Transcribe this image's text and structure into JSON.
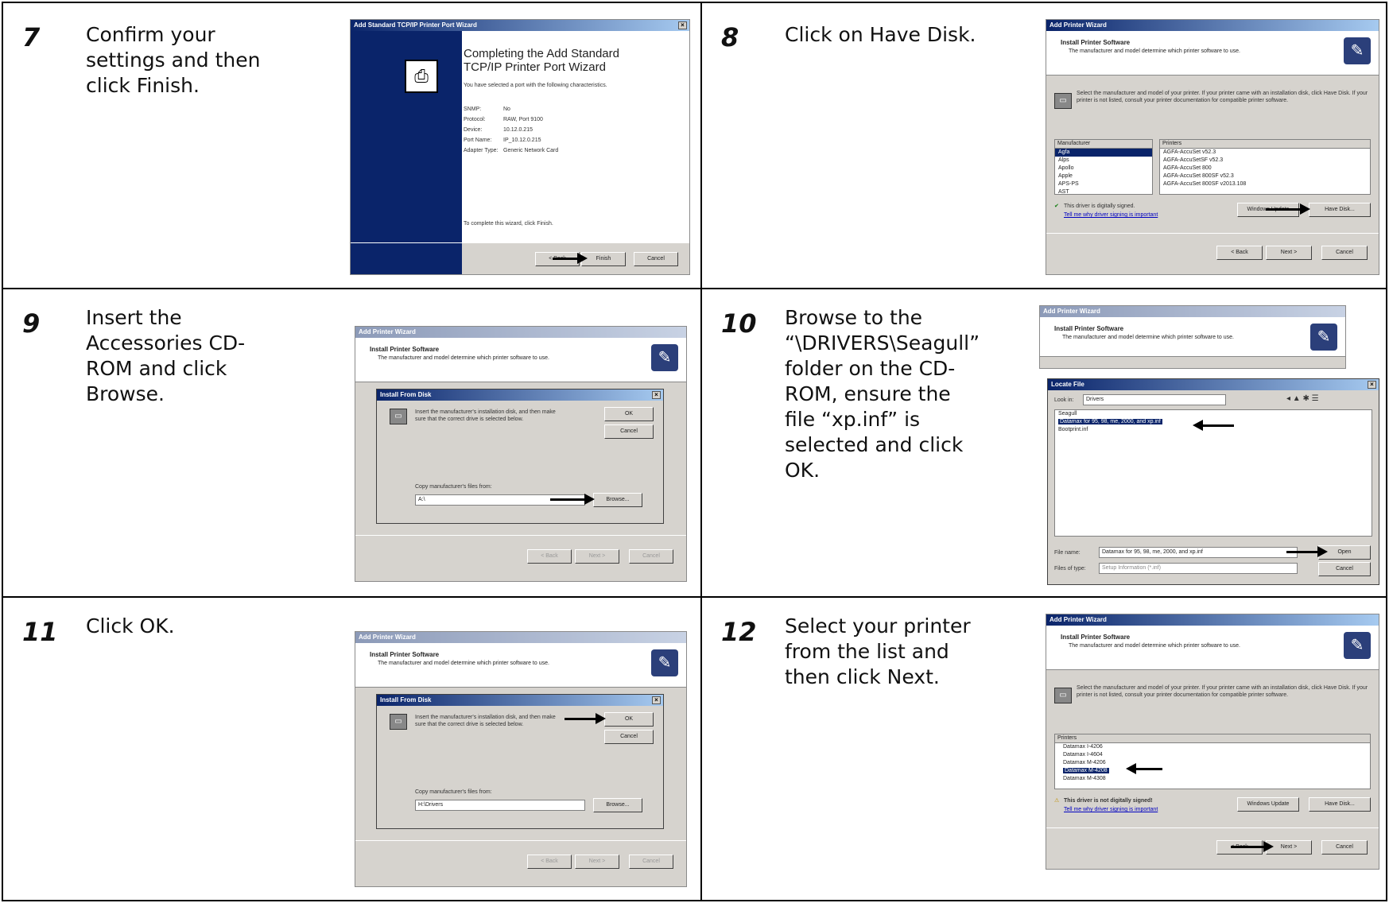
{
  "steps": [
    {
      "number": "7",
      "text": "Confirm your\nsettings and then\nclick Finish."
    },
    {
      "number": "8",
      "text": "Click on Have Disk."
    },
    {
      "number": "9",
      "text": "Insert the\nAccessories CD-\nROM and click\nBrowse."
    },
    {
      "number": "10",
      "text": "Browse to the\n“\\DRIVERS\\Seagull”\nfolder on the CD-\nROM, ensure the\nfile “xp.inf” is\nselected and click\nOK."
    },
    {
      "number": "11",
      "text": "Click OK."
    },
    {
      "number": "12",
      "text": "Select your printer\nfrom the list and\nthen click Next."
    }
  ],
  "shot7": {
    "window_title": "Add Standard TCP/IP Printer Port Wizard",
    "heading": "Completing the Add Standard\nTCP/IP Printer Port Wizard",
    "intro": "You have selected a port with the following characteristics.",
    "fields": [
      {
        "label": "SNMP:",
        "value": "No"
      },
      {
        "label": "Protocol:",
        "value": "RAW, Port 9100"
      },
      {
        "label": "Device:",
        "value": "10.12.0.215"
      },
      {
        "label": "Port Name:",
        "value": "IP_10.12.0.215"
      },
      {
        "label": "Adapter Type:",
        "value": "Generic Network Card"
      }
    ],
    "footer": "To complete this wizard, click Finish.",
    "back": "< Back",
    "finish": "Finish",
    "cancel": "Cancel"
  },
  "install_header": {
    "window_title": "Add Printer Wizard",
    "title": "Install Printer Software",
    "subtitle": "The manufacturer and model determine which printer software to use."
  },
  "shot8": {
    "instructions": "Select the manufacturer and model of your printer. If your printer came with an installation disk, click Have Disk. If your printer is not listed, consult your printer documentation for compatible printer software.",
    "manufacturer_header": "Manufacturer",
    "manufacturers": [
      "Agfa",
      "Alps",
      "Apollo",
      "Apple",
      "APS-PS",
      "AST"
    ],
    "printers_header": "Printers",
    "printers": [
      "AGFA-AccuSet v52.3",
      "AGFA-AccuSetSF v52.3",
      "AGFA-AccuSet 800",
      "AGFA-AccuSet 800SF v52.3",
      "AGFA-AccuSet 800SF v2013.108"
    ],
    "signed": "This driver is digitally signed.",
    "signing_link": "Tell me why driver signing is important",
    "windows_update": "Windows Update",
    "have_disk": "Have Disk...",
    "back": "< Back",
    "next": "Next >",
    "cancel": "Cancel"
  },
  "disk_dialog": {
    "title": "Install From Disk",
    "message": "Insert the manufacturer's installation disk, and then make sure that the correct drive is selected below.",
    "ok": "OK",
    "cancel": "Cancel",
    "copy_label": "Copy manufacturer's files from:",
    "path_empty": "A:\\",
    "path_filled": "H:\\Drivers",
    "browse": "Browse..."
  },
  "shot10": {
    "dialog_title": "Locate File",
    "look_in_label": "Look in:",
    "look_in_value": "Drivers",
    "files": [
      "Seagull",
      "Datamax for 95, 98, me, 2000, and xp.inf",
      "Bootprint.inf"
    ],
    "file_name_label": "File name:",
    "file_name_value": "Datamax for 95, 98, me, 2000, and xp.inf",
    "file_type_label": "Files of type:",
    "file_type_value": "Setup Information (*.inf)",
    "open": "Open",
    "cancel": "Cancel"
  },
  "shot12": {
    "printers_header": "Printers",
    "printers": [
      "Datamax I-4206",
      "Datamax I-4604",
      "Datamax M-4206",
      "Datamax M-4208",
      "Datamax M-4308"
    ],
    "unsigned": "This driver is not digitally signed!"
  }
}
